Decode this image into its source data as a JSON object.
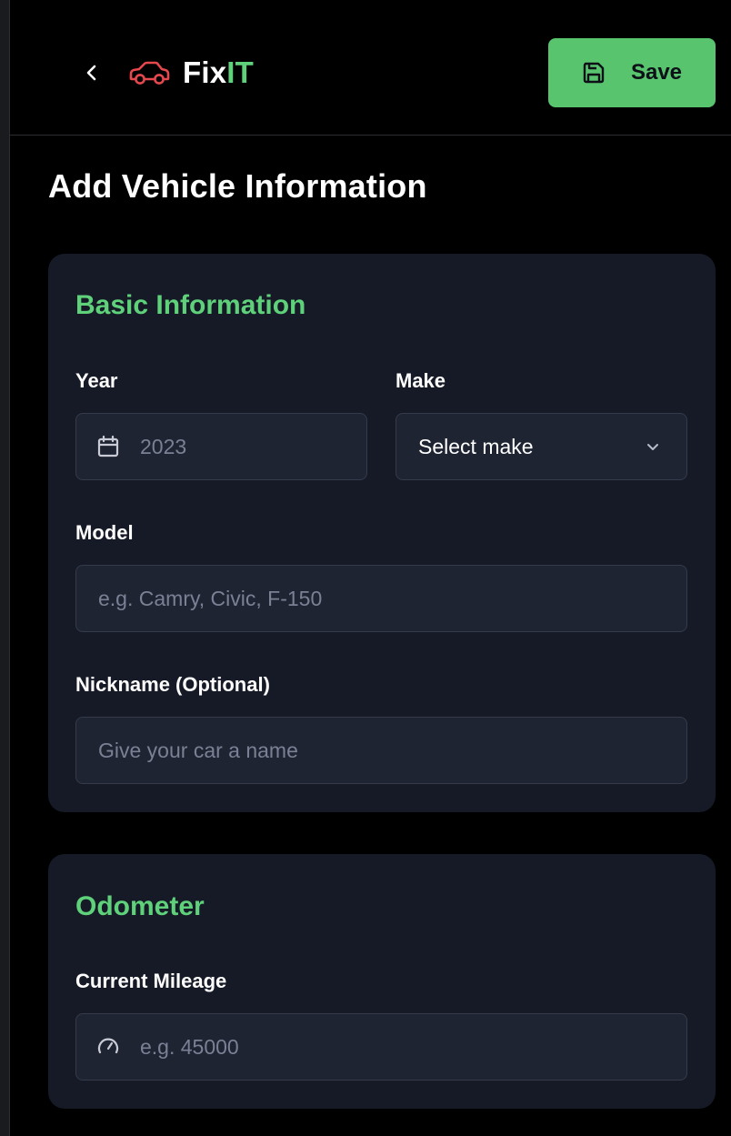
{
  "header": {
    "brand_part1": "Fix",
    "brand_part2": "IT",
    "save_label": "Save",
    "icons": {
      "back": "chevron-left-icon",
      "logo": "car-icon",
      "save": "save-icon"
    },
    "colors": {
      "accent": "#5fd17a",
      "save_bg": "#58c46e",
      "logo_red": "#e5484d"
    }
  },
  "page": {
    "title": "Add Vehicle Information"
  },
  "basic_info": {
    "section_title": "Basic Information",
    "year": {
      "label": "Year",
      "placeholder": "2023",
      "icon": "calendar-icon"
    },
    "make": {
      "label": "Make",
      "selected": "Select make",
      "icon": "chevron-down-icon"
    },
    "model": {
      "label": "Model",
      "placeholder": "e.g. Camry, Civic, F-150"
    },
    "nickname": {
      "label": "Nickname (Optional)",
      "placeholder": "Give your car a name"
    }
  },
  "odometer": {
    "section_title": "Odometer",
    "mileage": {
      "label": "Current Mileage",
      "placeholder": "e.g. 45000",
      "icon": "gauge-icon"
    }
  }
}
